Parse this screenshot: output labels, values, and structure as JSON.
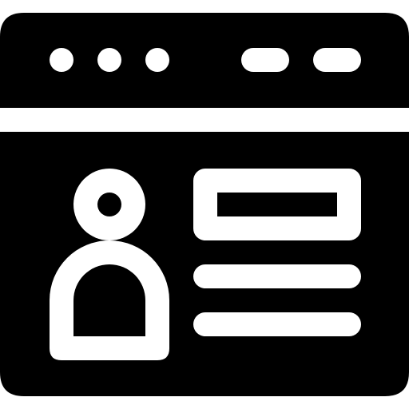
{
  "icon": {
    "name": "browser-profile-icon",
    "foreground": "#000000",
    "background": "#ffffff"
  },
  "title_bar": {
    "window_dots": 3,
    "pills": 2
  },
  "content": {
    "avatar": "user-avatar-icon",
    "text_lines": 2,
    "header_box": "profile-name-box"
  }
}
